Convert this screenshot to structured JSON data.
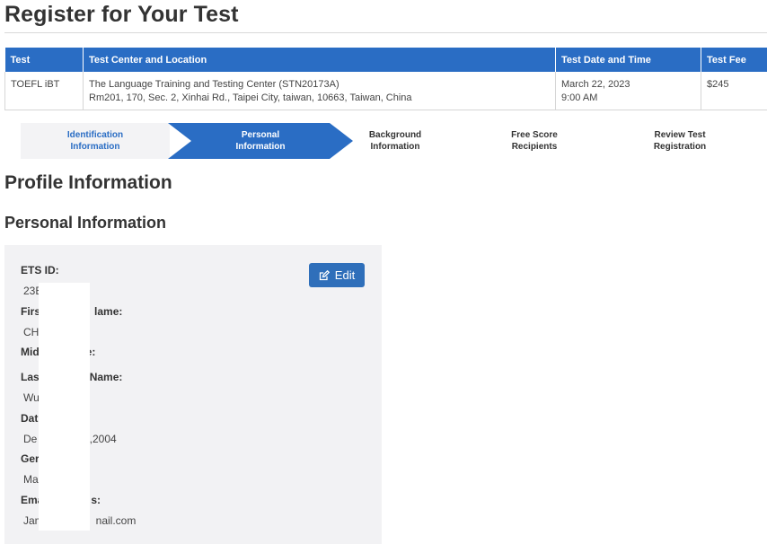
{
  "page": {
    "title": "Register for Your Test"
  },
  "test_table": {
    "headers": [
      "Test",
      "Test Center and Location",
      "Test Date and Time",
      "Test Fee"
    ],
    "row": {
      "test": "TOEFL iBT",
      "center": "The Language Training and Testing Center (STN20173A)",
      "address": "Rm201, 170, Sec. 2, Xinhai Rd.,  Taipei City,  taiwan,  10663,  Taiwan, China",
      "date": "March 22, 2023",
      "time": "9:00 AM",
      "fee": "$245"
    }
  },
  "stepper": {
    "steps": [
      {
        "line1": "Identification",
        "line2": "Information",
        "state": "completed"
      },
      {
        "line1": "Personal",
        "line2": "Information",
        "state": "active"
      },
      {
        "line1": "Background",
        "line2": "Information",
        "state": "upcoming"
      },
      {
        "line1": "Free Score",
        "line2": "Recipients",
        "state": "upcoming"
      },
      {
        "line1": "Review Test",
        "line2": "Registration",
        "state": "upcoming"
      }
    ]
  },
  "profile": {
    "section_title": "Profile Information",
    "subsection_title": "Personal Information",
    "edit_label": "Edit",
    "edit_icon": "edit-icon",
    "fields": [
      {
        "label": "ETS ID:",
        "value": "23E"
      },
      {
        "label": "First Name:",
        "value": "CH"
      },
      {
        "label": "Middle Name:",
        "value": ""
      },
      {
        "label": "Last Name:",
        "value": "Wu"
      },
      {
        "label": "Date of Birth:",
        "value": "Dec ,2004"
      },
      {
        "label": "Gender:",
        "value": "Ma"
      },
      {
        "label": "Email Address:",
        "value": "Jam nail.com"
      }
    ],
    "visible_fragments": {
      "ets_id": "23E",
      "first_label_a": "Firs",
      "first_label_b": "lame:",
      "first_value": "CH",
      "middle_label_a": "Mid",
      "middle_label_b": "e:",
      "last_label_a": "Las",
      "last_label_b": "Name:",
      "last_value": "Wu",
      "dob_label_a": "Dat",
      "dob_label_b": ":",
      "dob_value_a": "De",
      "dob_value_b": "',2004",
      "gender_label": "Ger",
      "gender_value": "Ma",
      "email_label_a": "Ema",
      "email_label_b": "s:",
      "email_value_a": "Jam",
      "email_value_b": "nail.com"
    }
  },
  "colors": {
    "primary": "#2a6dc4",
    "button": "#2f6fba",
    "card_bg": "#f2f2f4",
    "step_done_bg": "#f3f3f5"
  }
}
